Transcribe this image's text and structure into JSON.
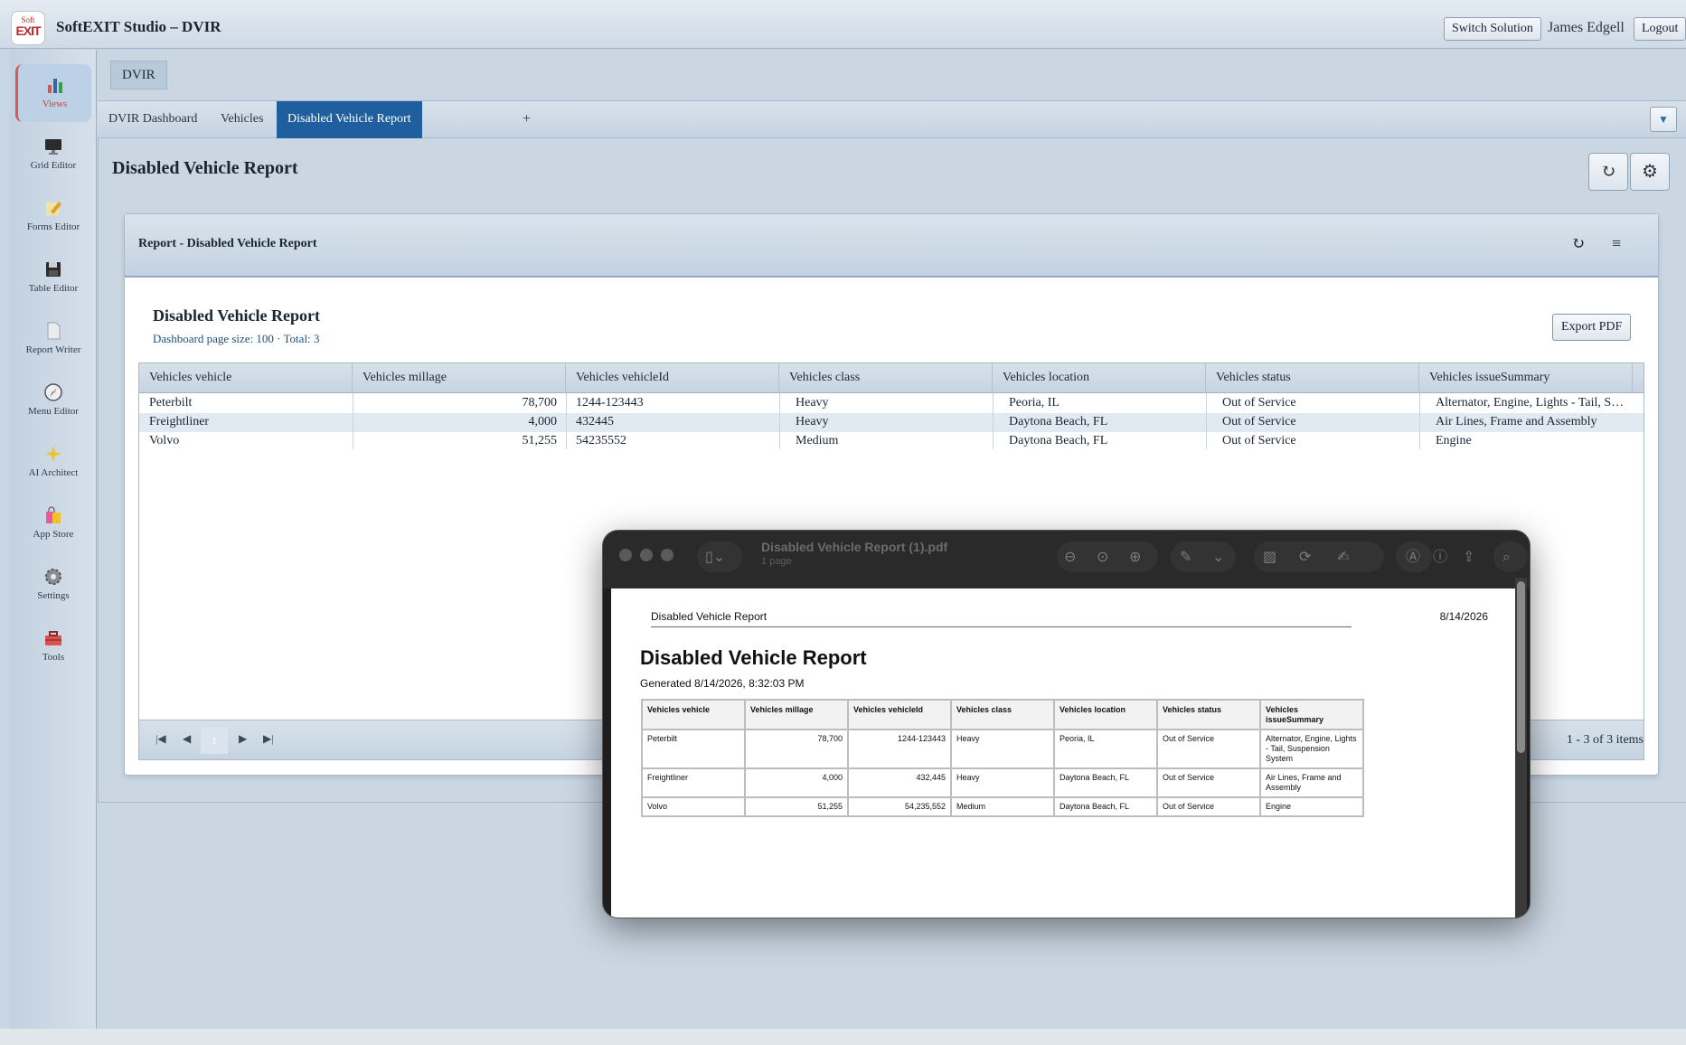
{
  "app": {
    "logo_top": "Soft",
    "logo_bottom": "EXIT",
    "title": "SoftEXIT Studio – DVIR",
    "switch_solution": "Switch Solution",
    "user_name": "James Edgell",
    "logout": "Logout"
  },
  "sidebar": {
    "items": [
      {
        "label": "Views",
        "icon": "bar-chart-icon"
      },
      {
        "label": "Grid Editor",
        "icon": "monitor-icon"
      },
      {
        "label": "Forms Editor",
        "icon": "pencil-icon"
      },
      {
        "label": "Table Editor",
        "icon": "floppy-disk-icon"
      },
      {
        "label": "Report Writer",
        "icon": "document-icon"
      },
      {
        "label": "Menu Editor",
        "icon": "compass-icon"
      },
      {
        "label": "AI Architect",
        "icon": "sparkles-icon"
      },
      {
        "label": "App Store",
        "icon": "shopping-bag-icon"
      },
      {
        "label": "Settings",
        "icon": "gear-icon"
      },
      {
        "label": "Tools",
        "icon": "toolbox-icon"
      }
    ]
  },
  "module_tab": "DVIR",
  "tabs": [
    {
      "label": "DVIR Dashboard"
    },
    {
      "label": "Vehicles"
    },
    {
      "label": "Disabled Vehicle Report"
    }
  ],
  "tab_add": "+",
  "page_title": "Disabled Vehicle Report",
  "panel": {
    "title": "Report - Disabled Vehicle Report",
    "report_title": "Disabled Vehicle Report",
    "report_subtitle": "Dashboard page size: 100 · Total: 3",
    "export_label": "Export PDF"
  },
  "grid": {
    "columns": [
      "Vehicles vehicle",
      "Vehicles millage",
      "Vehicles vehicleId",
      "Vehicles class",
      "Vehicles location",
      "Vehicles status",
      "Vehicles issueSummary"
    ],
    "rows": [
      [
        "Peterbilt",
        "78,700",
        "1244-123443",
        "Heavy",
        "Peoria, IL",
        "Out of Service",
        "Alternator, Engine, Lights - Tail, S…"
      ],
      [
        "Freightliner",
        "4,000",
        "432445",
        "Heavy",
        "Daytona Beach, FL",
        "Out of Service",
        "Air Lines, Frame and Assembly"
      ],
      [
        "Volvo",
        "51,255",
        "54235552",
        "Medium",
        "Daytona Beach, FL",
        "Out of Service",
        "Engine"
      ]
    ],
    "pager": {
      "current_page": "1",
      "info": "1 - 3 of 3 items"
    }
  },
  "pdf": {
    "window_title": "Disabled Vehicle Report (1).pdf",
    "window_subtitle": "1 page",
    "header_left": "Disabled Vehicle Report",
    "header_right": "8/14/2026",
    "title": "Disabled Vehicle Report",
    "generated": "Generated 8/14/2026, 8:32:03 PM",
    "columns": [
      "Vehicles vehicle",
      "Vehicles millage",
      "Vehicles vehicleId",
      "Vehicles class",
      "Vehicles location",
      "Vehicles status",
      "Vehicles issueSummary"
    ],
    "rows": [
      [
        "Peterbilt",
        "78,700",
        "1244-123443",
        "Heavy",
        "Peoria, IL",
        "Out of Service",
        "Alternator, Engine, Lights - Tail, Suspension System"
      ],
      [
        "Freightliner",
        "4,000",
        "432,445",
        "Heavy",
        "Daytona Beach, FL",
        "Out of Service",
        "Air Lines, Frame and Assembly"
      ],
      [
        "Volvo",
        "51,255",
        "54,235,552",
        "Medium",
        "Daytona Beach, FL",
        "Out of Service",
        "Engine"
      ]
    ]
  }
}
